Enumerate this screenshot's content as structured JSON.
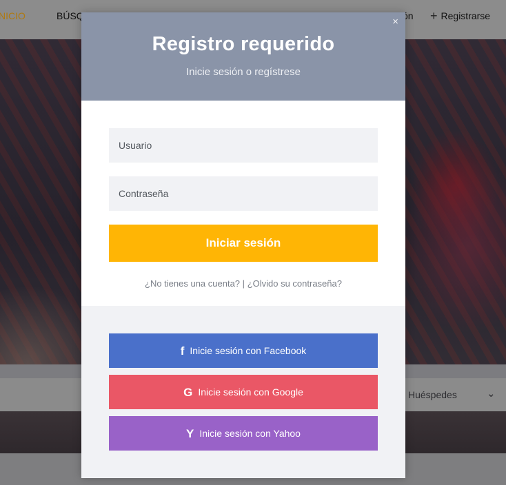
{
  "topbar": {
    "home": "NICIO",
    "search": "BÚSQ",
    "login": "ón",
    "register": "Registrarse"
  },
  "searchbar": {
    "guests": "Huéspedes"
  },
  "modal": {
    "title": "Registro requerido",
    "subtitle": "Inicie sesión o regístrese",
    "close": "×",
    "username_placeholder": "Usuario",
    "password_placeholder": "Contraseña",
    "login_button": "Iniciar sesión",
    "no_account_link": "¿No tienes una cuenta?",
    "separator": "|",
    "forgot_link": "¿Olvido su contraseña?",
    "facebook_button": "Inicie sesión con Facebook",
    "google_button": "Inicie sesión con Google",
    "yahoo_button": "Inicie sesión con Yahoo"
  },
  "colors": {
    "header": "#8a94a8",
    "login_button": "#ffb505",
    "facebook": "#4a70ca",
    "google": "#ea5766",
    "yahoo": "#9962c8"
  },
  "icons": {
    "facebook": "facebook-icon",
    "google": "google-icon",
    "yahoo": "yahoo-icon",
    "close": "close-icon",
    "register": "plus-icon",
    "guests_dropdown": "chevron-down-icon"
  }
}
